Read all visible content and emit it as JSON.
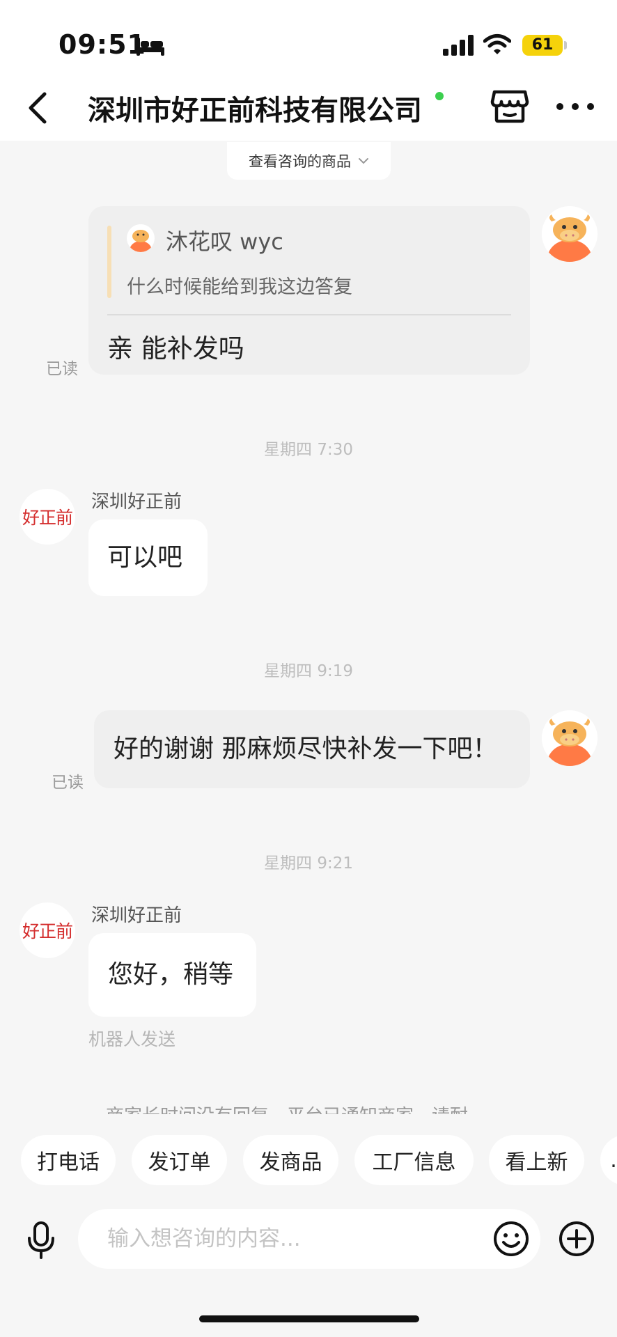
{
  "status_bar": {
    "time": "09:51",
    "battery": "61",
    "icons": [
      "bed-icon",
      "signal-icon",
      "wifi-icon",
      "battery-icon"
    ]
  },
  "header": {
    "title": "深圳市好正前科技有限公司",
    "online_color": "#3ccf4e",
    "icons": [
      "back-arrow-icon",
      "shop-icon",
      "more-icon"
    ]
  },
  "consult_chip": {
    "label": "查看咨询的商品"
  },
  "messages": [
    {
      "from": "user",
      "quote": {
        "name": "沐花叹 wyc",
        "text": "什么时候能给到我这边答复"
      },
      "text": "亲 能补发吗",
      "status": "已读"
    },
    {
      "type": "time",
      "text": "星期四 7:30"
    },
    {
      "from": "shop",
      "avatar_text": "好正前",
      "sender": "深圳好正前",
      "text": "可以吧"
    },
    {
      "type": "time",
      "text": "星期四 9:19"
    },
    {
      "from": "user",
      "text": "好的谢谢 那麻烦尽快补发一下吧！",
      "status": "已读"
    },
    {
      "type": "time",
      "text": "星期四 9:21"
    },
    {
      "from": "shop",
      "avatar_text": "好正前",
      "sender": "深圳好正前",
      "text": "您好，稍等",
      "note": "机器人发送"
    }
  ],
  "notice": {
    "text": "商家长时间没有回复，平台已通知商家，请耐"
  },
  "quick_actions": [
    {
      "label": "打电话"
    },
    {
      "label": "发订单"
    },
    {
      "label": "发商品"
    },
    {
      "label": "工厂信息"
    },
    {
      "label": "看上新"
    },
    {
      "label": "…"
    }
  ],
  "input": {
    "placeholder": "输入想咨询的内容..."
  },
  "colors": {
    "accent_red": "#d42e2e",
    "avatar_orange": "#ff7a45",
    "bg": "#f6f6f6"
  }
}
